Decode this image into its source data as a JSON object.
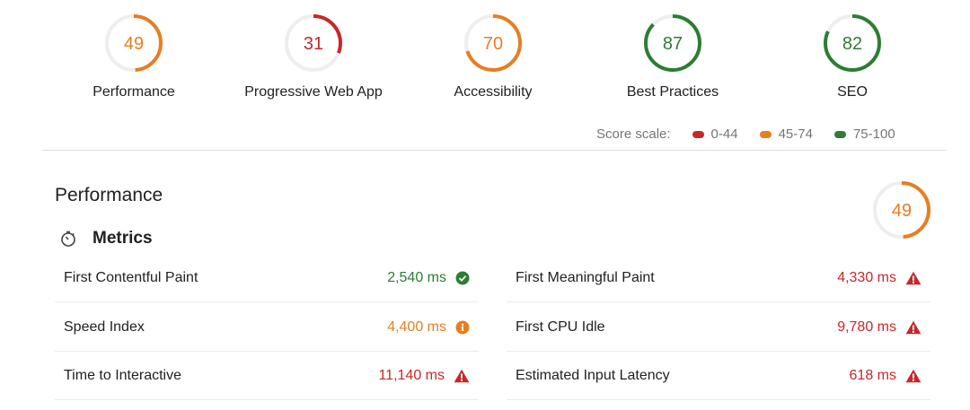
{
  "colors": {
    "fail": "#c62828",
    "average": "#e67e22",
    "pass": "#2e7d32",
    "track": "#eeeeee"
  },
  "scores": [
    {
      "value": "49",
      "label": "Performance",
      "status": "average"
    },
    {
      "value": "31",
      "label": "Progressive Web App",
      "status": "fail"
    },
    {
      "value": "70",
      "label": "Accessibility",
      "status": "average"
    },
    {
      "value": "87",
      "label": "Best Practices",
      "status": "pass"
    },
    {
      "value": "82",
      "label": "SEO",
      "status": "pass"
    }
  ],
  "score_scale": {
    "label": "Score scale:",
    "ranges": [
      {
        "text": "0-44",
        "status": "fail"
      },
      {
        "text": "45-74",
        "status": "average"
      },
      {
        "text": "75-100",
        "status": "pass"
      }
    ]
  },
  "performance": {
    "title": "Performance",
    "score": "49",
    "score_status": "average",
    "metrics_label": "Metrics",
    "metrics_icon": "stopwatch-icon",
    "metrics": [
      {
        "name": "First Contentful Paint",
        "value": "2,540 ms",
        "status": "pass",
        "icon": "check-circle-icon"
      },
      {
        "name": "First Meaningful Paint",
        "value": "4,330 ms",
        "status": "fail",
        "icon": "warning-triangle-icon"
      },
      {
        "name": "Speed Index",
        "value": "4,400 ms",
        "status": "average",
        "icon": "info-circle-icon"
      },
      {
        "name": "First CPU Idle",
        "value": "9,780 ms",
        "status": "fail",
        "icon": "warning-triangle-icon"
      },
      {
        "name": "Time to Interactive",
        "value": "11,140 ms",
        "status": "fail",
        "icon": "warning-triangle-icon"
      },
      {
        "name": "Estimated Input Latency",
        "value": "618 ms",
        "status": "fail",
        "icon": "warning-triangle-icon"
      }
    ]
  }
}
